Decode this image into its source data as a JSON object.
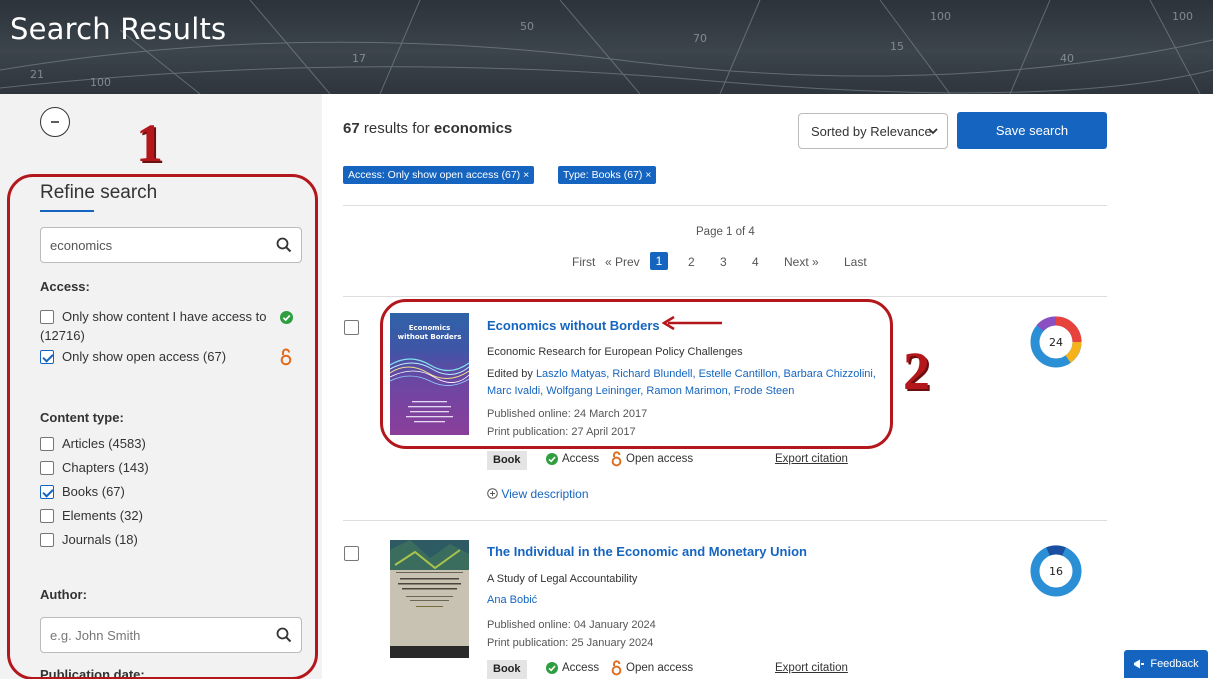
{
  "header": {
    "title": "Search Results"
  },
  "annotations": {
    "label_1": "1",
    "label_2": "2"
  },
  "sidebar": {
    "refine_title": "Refine search",
    "search_value": "economics",
    "access_heading": "Access:",
    "access_options": [
      {
        "label": "Only show content I have access to",
        "count": "(12716)",
        "checked": false,
        "icon": "check-circle-icon"
      },
      {
        "label": "Only show open access (67)",
        "checked": true,
        "icon": "open-access-icon"
      }
    ],
    "content_type_heading": "Content type:",
    "content_types": [
      {
        "label": "Articles (4583)",
        "checked": false
      },
      {
        "label": "Chapters (143)",
        "checked": false
      },
      {
        "label": "Books (67)",
        "checked": true
      },
      {
        "label": "Elements (32)",
        "checked": false
      },
      {
        "label": "Journals (18)",
        "checked": false
      }
    ],
    "author_heading": "Author:",
    "author_placeholder": "e.g. John Smith",
    "publication_date_heading": "Publication date:"
  },
  "main": {
    "results_count": "67",
    "results_for": "results for",
    "query": "economics",
    "sort_label": "Sorted by Relevance",
    "save_button": "Save search",
    "active_filters": [
      "Access: Only show open access (67) ×",
      "Type: Books (67) ×"
    ],
    "pagination": {
      "page_of": "Page 1 of 4",
      "first": "First",
      "prev": "« Prev",
      "pages": [
        "1",
        "2",
        "3",
        "4"
      ],
      "current": "1",
      "next": "Next »",
      "last": "Last"
    },
    "results": [
      {
        "title": "Economics without Borders",
        "subtitle": "Economic Research for European Policy Challenges",
        "edited_by": "Edited by",
        "authors": "Laszlo Matyas, Richard Blundell, Estelle Cantillon, Barbara Chizzolini, Marc Ivaldi, Wolfgang Leininger, Ramon Marimon, Frode Steen",
        "published_online": "Published online: 24 March 2017",
        "print_publication": "Print publication: 27 April 2017",
        "type_badge": "Book",
        "access_label": "Access",
        "open_access_label": "Open access",
        "export_label": "Export citation",
        "view_description": "View description",
        "altmetric_score": "24",
        "cover_text": {
          "title_line1": "Economics",
          "title_line2": "without Borders"
        }
      },
      {
        "title": "The Individual in the Economic and Monetary Union",
        "subtitle": "A Study of Legal Accountability",
        "authors": "Ana Bobić",
        "published_online": "Published online: 04 January 2024",
        "print_publication": "Print publication: 25 January 2024",
        "type_badge": "Book",
        "access_label": "Access",
        "open_access_label": "Open access",
        "export_label": "Export citation",
        "altmetric_score": "16"
      }
    ]
  },
  "feedback_button": "Feedback",
  "colors": {
    "accent": "#1565c0",
    "annotation_red": "#b3171b",
    "access_green": "#2e9e3f",
    "open_access_orange": "#e06a1b"
  }
}
